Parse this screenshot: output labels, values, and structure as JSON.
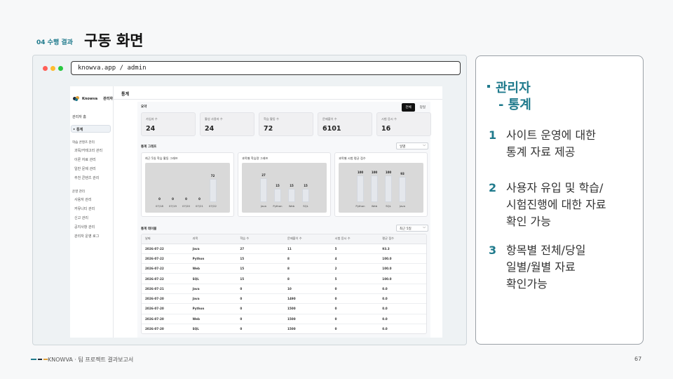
{
  "slide": {
    "section": "04 수행 결과",
    "title": "구동 화면",
    "footer": "KNOWVA · 팀 프로젝트 결과보고서",
    "page": "67"
  },
  "browser": {
    "url": "knowva.app / admin"
  },
  "sidebar": {
    "brand": "Knowva",
    "role": "관리자",
    "items": [
      "관리자 홈",
      "통계",
      "학습 콘텐츠 관리",
      "과목/카테고리 관리",
      "이론 자료 관리",
      "일반 문제 관리",
      "추천 콘텐츠 관리",
      "운영 관리",
      "사용자 관리",
      "커뮤니티 관리",
      "신고 관리",
      "공지사항 관리",
      "관리자 운영 로그"
    ]
  },
  "main": {
    "title": "통계",
    "summary_label": "요약",
    "toggle": [
      "전체",
      "당일"
    ],
    "stats": [
      {
        "label": "가입자 수",
        "value": "24"
      },
      {
        "label": "활성 사용자 수",
        "value": "24"
      },
      {
        "label": "학습 활동 수",
        "value": "72"
      },
      {
        "label": "문제풀이 수",
        "value": "6101"
      },
      {
        "label": "시험 응시 수",
        "value": "16"
      }
    ],
    "graph_label": "통계 그래프",
    "graph_select": "일별",
    "table_label": "통계 테이블",
    "table_select": "최근 5일",
    "table": {
      "headers": [
        "날짜",
        "과목",
        "학습 수",
        "문제풀이 수",
        "시험 응시 수",
        "평균 점수"
      ],
      "rows": [
        [
          "2026-07-22",
          "Java",
          "27",
          "11",
          "5",
          "93.3"
        ],
        [
          "2026-07-22",
          "Python",
          "15",
          "8",
          "4",
          "100.0"
        ],
        [
          "2026-07-22",
          "Web",
          "15",
          "8",
          "2",
          "100.0"
        ],
        [
          "2026-07-22",
          "SQL",
          "15",
          "8",
          "5",
          "100.0"
        ],
        [
          "2026-07-21",
          "Java",
          "0",
          "10",
          "0",
          "0.0"
        ],
        [
          "2026-07-20",
          "Java",
          "0",
          "1490",
          "0",
          "0.0"
        ],
        [
          "2026-07-20",
          "Python",
          "0",
          "1500",
          "0",
          "0.0"
        ],
        [
          "2026-07-20",
          "Web",
          "0",
          "1500",
          "0",
          "0.0"
        ],
        [
          "2026-07-20",
          "SQL",
          "0",
          "1500",
          "0",
          "0.0"
        ]
      ]
    }
  },
  "chart_data": [
    {
      "type": "bar",
      "title": "최근 5일 학습 활동 그래프",
      "categories": [
        "07/18",
        "07/19",
        "07/20",
        "07/21",
        "07/22"
      ],
      "values": [
        0,
        0,
        0,
        0,
        72
      ],
      "ylim": [
        0,
        100
      ]
    },
    {
      "type": "bar",
      "title": "과목별 학습량 그래프",
      "categories": [
        "Java",
        "Python",
        "Web",
        "SQL"
      ],
      "values": [
        27,
        15,
        15,
        15
      ],
      "ylim": [
        0,
        36
      ]
    },
    {
      "type": "bar",
      "title": "과목별 시험 평균 점수",
      "categories": [
        "Python",
        "Web",
        "SQL",
        "Java"
      ],
      "values": [
        100,
        100,
        100,
        93
      ],
      "ylim": [
        0,
        120
      ]
    }
  ],
  "panel": {
    "title_line1": "관리자",
    "title_line2": "- 통계",
    "points": [
      {
        "num": "1",
        "lines": [
          "사이트 운영에 대한",
          "통계 자료 제공"
        ]
      },
      {
        "num": "2",
        "lines": [
          "사용자 유입 및 학습/",
          "시험진행에 대한 자료",
          "확인 가능"
        ]
      },
      {
        "num": "3",
        "lines": [
          "항목별 전체/당일",
          "일별/월별 자료",
          "확인가능"
        ]
      }
    ]
  },
  "colors": {
    "accent": "#1f7a8c",
    "dot_red": "#ff5f57",
    "dot_yellow": "#febc2e",
    "dot_green": "#28c840"
  }
}
